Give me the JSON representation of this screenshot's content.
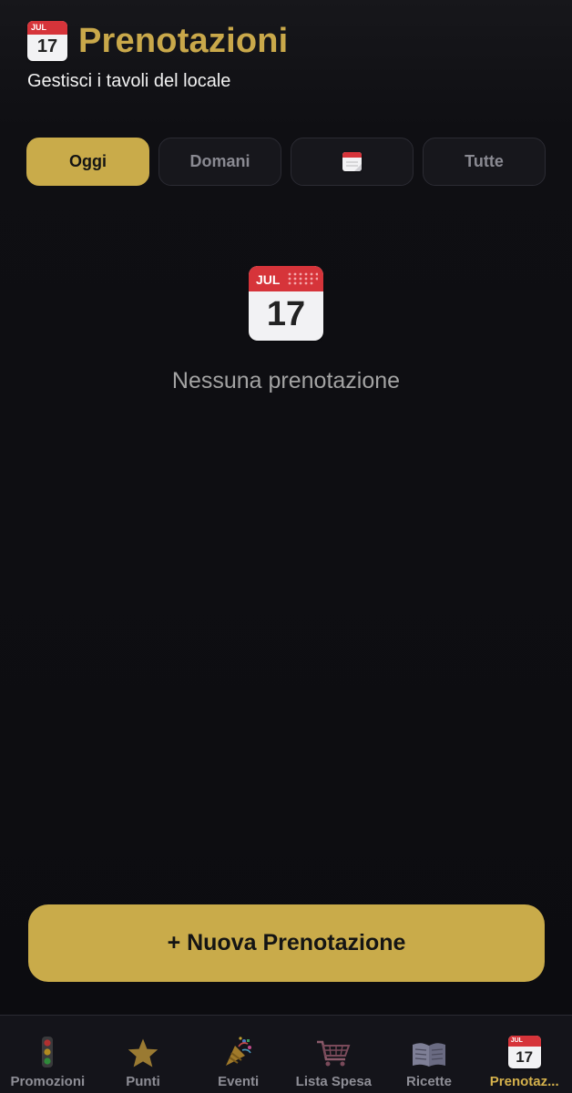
{
  "header": {
    "title": "Prenotazioni",
    "subtitle": "Gestisci i tavoli del locale",
    "calendar_month": "JUL",
    "calendar_day": "17"
  },
  "tabs": [
    {
      "label": "Oggi",
      "active": true
    },
    {
      "label": "Domani",
      "active": false
    },
    {
      "label": "",
      "icon": "calendar-icon",
      "active": false
    },
    {
      "label": "Tutte",
      "active": false
    }
  ],
  "empty_state": {
    "icon": "calendar-icon",
    "month": "JUL",
    "day": "17",
    "message": "Nessuna prenotazione"
  },
  "new_booking_button": "+ Nuova Prenotazione",
  "bottom_nav": [
    {
      "label": "Promozioni",
      "icon": "traffic-light-icon",
      "active": false
    },
    {
      "label": "Punti",
      "icon": "star-icon",
      "active": false
    },
    {
      "label": "Eventi",
      "icon": "party-popper-icon",
      "active": false
    },
    {
      "label": "Lista Spesa",
      "icon": "shopping-cart-icon",
      "active": false
    },
    {
      "label": "Ricette",
      "icon": "book-icon",
      "active": false
    },
    {
      "label": "Prenotaz...",
      "icon": "calendar-icon",
      "active": true,
      "month": "JUL",
      "day": "17"
    }
  ],
  "colors": {
    "accent": "#c9ab4a",
    "background": "#0c0c10",
    "inactive_text": "#8a8a92",
    "calendar_red": "#d6343a"
  }
}
